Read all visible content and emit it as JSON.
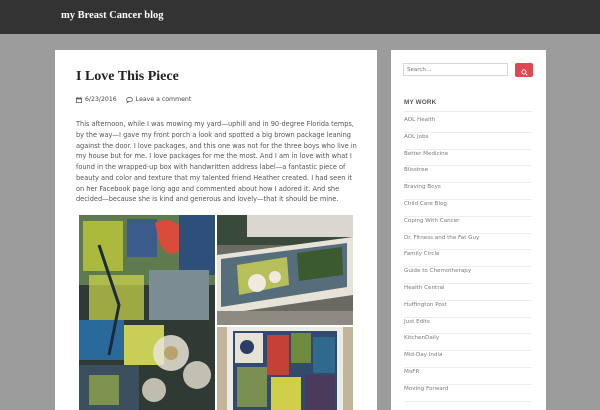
{
  "header": {
    "site_title": "my Breast Cancer blog"
  },
  "post": {
    "title": "I Love This Piece",
    "date": "6/23/2016",
    "comment_link": "Leave a comment",
    "body": "This afternoon, while I was mowing my yard—uphill and in 90-degree Florida temps, by the way—I gave my front porch a look and spotted a big brown package leaning against the door. I love packages, and this one was not for the three boys who live in my house but for me. I love packages for me the most. And I am in love with what I found in the wrapped-up box with handwritten address label—a fantastic piece of beauty and color and texture that my talented friend Heather created. I had seen it on her Facebook page long ago and commented about how I adored it. And she decided—because she is kind and generous and lovely—that it should be mine."
  },
  "sidebar": {
    "search": {
      "placeholder": "Search..."
    },
    "widget_title": "MY WORK",
    "links": [
      "AOL Health",
      "AOL Jobs",
      "Better Medicine",
      "Blisstree",
      "Braving Boys",
      "Child Care Blog",
      "Coping With Cancer",
      "Dr. Fitness and the Fat Guy",
      "Family Circle",
      "Guide to Chemotherapy",
      "Health Central",
      "Huffington Post",
      "Just Edits",
      "KitchenDaily",
      "Mid-Day India",
      "MoFR",
      "Moving Forward"
    ]
  },
  "colors": {
    "background": "#9c9c9c",
    "topbar": "#333333",
    "accent": "#e1474f"
  },
  "icons": [
    "calendar-icon",
    "comment-icon",
    "search-icon"
  ]
}
